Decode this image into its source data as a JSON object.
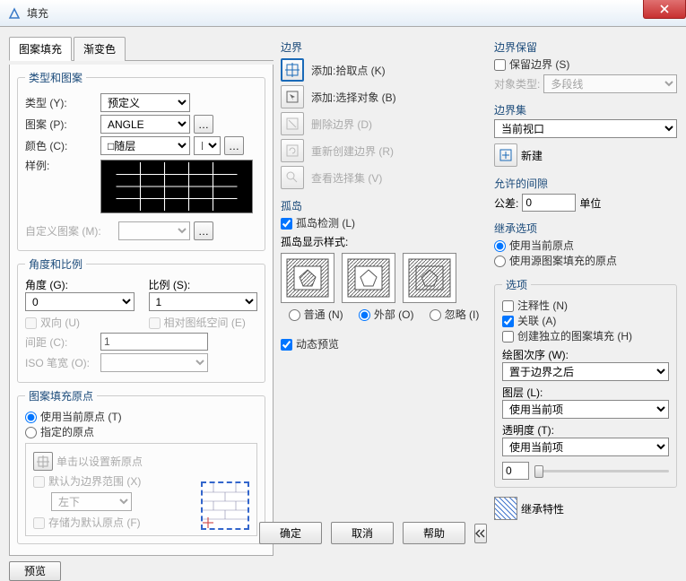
{
  "window": {
    "title": "填充"
  },
  "tabs": {
    "hatch": "图案填充",
    "gradient": "渐变色"
  },
  "type_pattern": {
    "legend": "类型和图案",
    "type_lbl": "类型 (Y):",
    "type_val": "预定义",
    "pattern_lbl": "图案 (P):",
    "pattern_val": "ANGLE",
    "color_lbl": "颜色 (C):",
    "color_val": "□随层",
    "sample_lbl": "样例:",
    "custom_lbl": "自定义图案 (M):"
  },
  "angle_scale": {
    "legend": "角度和比例",
    "angle_lbl": "角度 (G):",
    "angle_val": "0",
    "scale_lbl": "比例 (S):",
    "scale_val": "1",
    "double_lbl": "双向 (U)",
    "relative_lbl": "相对图纸空间 (E)",
    "spacing_lbl": "间距 (C):",
    "spacing_val": "1",
    "iso_lbl": "ISO 笔宽 (O):"
  },
  "origin": {
    "legend": "图案填充原点",
    "use_current": "使用当前原点 (T)",
    "specified": "指定的原点",
    "click_set": "单击以设置新原点",
    "default_extent": "默认为边界范围 (X)",
    "pos_val": "左下",
    "store_default": "存储为默认原点 (F)"
  },
  "preview_btn": "预览",
  "boundary": {
    "legend": "边界",
    "add_pick": "添加:拾取点 (K)",
    "add_select": "添加:选择对象 (B)",
    "remove": "删除边界 (D)",
    "recreate": "重新创建边界 (R)",
    "view_sel": "查看选择集 (V)"
  },
  "islands": {
    "legend": "孤岛",
    "detect": "孤岛检测 (L)",
    "style_lbl": "孤岛显示样式:",
    "normal": "普通 (N)",
    "outer": "外部 (O)",
    "ignore": "忽略 (I)"
  },
  "dynamic_preview": "动态预览",
  "retain": {
    "legend": "边界保留",
    "keep": "保留边界 (S)",
    "obj_type_lbl": "对象类型:",
    "obj_type_val": "多段线"
  },
  "boundary_set": {
    "legend": "边界集",
    "val": "当前视口",
    "new_btn": "新建"
  },
  "gap": {
    "legend": "允许的间隙",
    "tol_lbl": "公差:",
    "tol_val": "0",
    "unit": "单位"
  },
  "inherit": {
    "legend": "继承选项",
    "use_current": "使用当前原点",
    "use_source": "使用源图案填充的原点"
  },
  "options": {
    "legend": "选项",
    "annotative": "注释性 (N)",
    "assoc": "关联 (A)",
    "separate": "创建独立的图案填充 (H)",
    "draw_order_lbl": "绘图次序 (W):",
    "draw_order_val": "置于边界之后",
    "layer_lbl": "图层 (L):",
    "layer_val": "使用当前项",
    "trans_lbl": "透明度 (T):",
    "trans_val": "使用当前项",
    "trans_num": "0"
  },
  "inherit_props": "继承特性",
  "buttons": {
    "ok": "确定",
    "cancel": "取消",
    "help": "帮助"
  }
}
